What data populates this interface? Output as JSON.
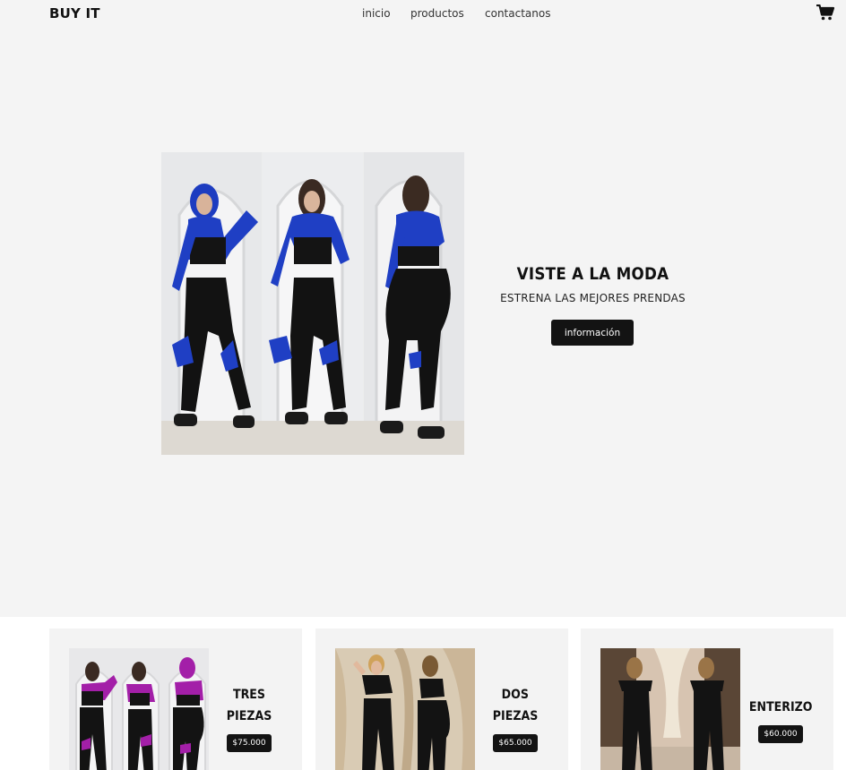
{
  "header": {
    "logo": "BUY IT",
    "nav": [
      "inicio",
      "productos",
      "contactanos"
    ],
    "cart_icon": "shopping-cart-icon"
  },
  "hero": {
    "title": "VISTE A LA MODA",
    "subtitle": "ESTRENA LAS MEJORES PRENDAS",
    "button_label": "información"
  },
  "products": [
    {
      "name_line1": "TRES",
      "name_line2": "PIEZAS",
      "price": "$75.000"
    },
    {
      "name_line1": "DOS",
      "name_line2": "PIEZAS",
      "price": "$65.000"
    },
    {
      "name_line1": "ENTERIZO",
      "name_line2": "",
      "price": "$60.000"
    }
  ],
  "colors": {
    "hero_background": "#f4f4f4",
    "button": "#131313",
    "card_background": "#f3f3f3",
    "accent_blue": "#1f3fc4",
    "accent_magenta": "#a31fa8"
  }
}
